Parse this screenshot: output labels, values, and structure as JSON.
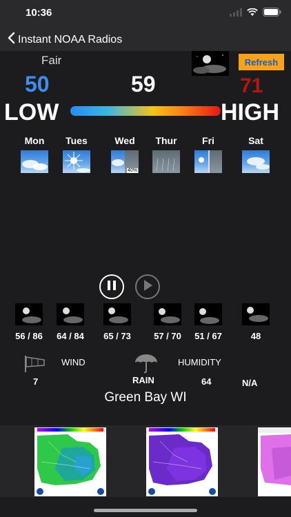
{
  "status_bar": {
    "time": "10:36"
  },
  "nav": {
    "back_label": "Instant NOAA Radios"
  },
  "current": {
    "condition": "Fair",
    "refresh_label": "Refresh",
    "low": "50",
    "current_temp": "59",
    "high": "71",
    "low_label": "LOW",
    "high_label": "HIGH"
  },
  "days": [
    {
      "label": "Mon",
      "icon": "partly-cloudy-icon"
    },
    {
      "label": "Tues",
      "icon": "sunny-icon"
    },
    {
      "label": "Wed",
      "icon": "partly-cloudy-rain-icon",
      "precip": "40%"
    },
    {
      "label": "Thur",
      "icon": "rain-icon"
    },
    {
      "label": "Fri",
      "icon": "clear-rain-icon"
    },
    {
      "label": "Sat",
      "icon": "partly-cloudy-icon"
    }
  ],
  "hourly": [
    {
      "temps": "56 / 86"
    },
    {
      "temps": "64 / 84"
    },
    {
      "temps": "65 / 73"
    },
    {
      "temps": "57 / 70"
    },
    {
      "temps": "51 / 67"
    },
    {
      "temps": "48"
    }
  ],
  "conditions": {
    "wind_label": "WIND",
    "wind_value": "7",
    "rain_label": "RAIN",
    "humidity_label": "HUMIDITY",
    "humidity_value": "64",
    "rain_value": "N/A"
  },
  "location": "Green Bay WI",
  "colors": {
    "accent_orange": "#f7a21b",
    "low_blue": "#3e8df0",
    "high_red": "#b71414"
  }
}
